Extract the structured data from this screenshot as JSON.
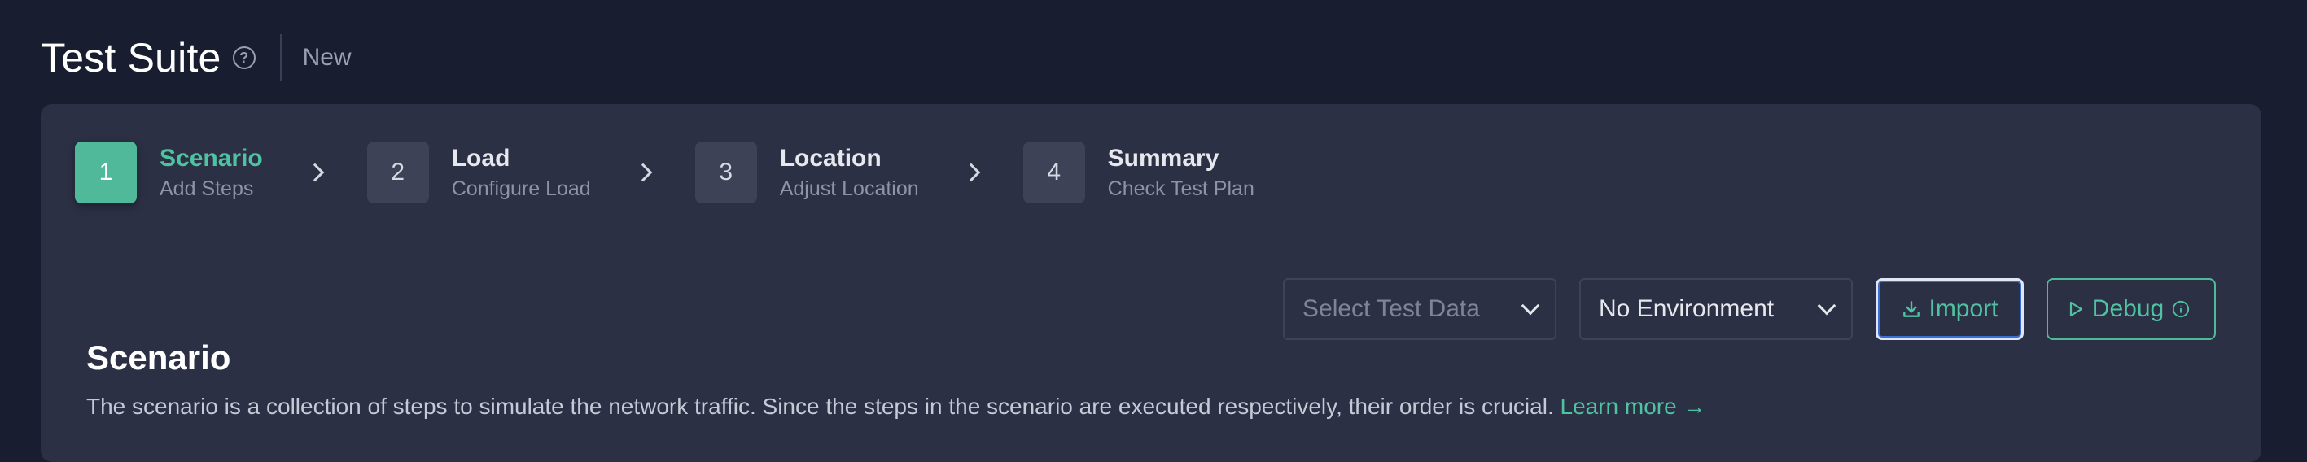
{
  "header": {
    "title": "Test Suite",
    "help_icon": "question-circle-icon",
    "status": "New"
  },
  "stepper": {
    "steps": [
      {
        "number": "1",
        "title": "Scenario",
        "subtitle": "Add Steps",
        "active": true
      },
      {
        "number": "2",
        "title": "Load",
        "subtitle": "Configure Load",
        "active": false
      },
      {
        "number": "3",
        "title": "Location",
        "subtitle": "Adjust Location",
        "active": false
      },
      {
        "number": "4",
        "title": "Summary",
        "subtitle": "Check Test Plan",
        "active": false
      }
    ]
  },
  "actions": {
    "test_data_placeholder": "Select Test Data",
    "environment_value": "No Environment",
    "import_label": "Import",
    "debug_label": "Debug"
  },
  "section": {
    "title": "Scenario",
    "description": "The scenario is a collection of steps to simulate the network traffic. Since the steps in the scenario are executed respectively, their order is crucial.",
    "learn_more": "Learn more →"
  },
  "colors": {
    "accent": "#4fc3a1",
    "background": "#181d2f",
    "card": "#2c3045"
  }
}
